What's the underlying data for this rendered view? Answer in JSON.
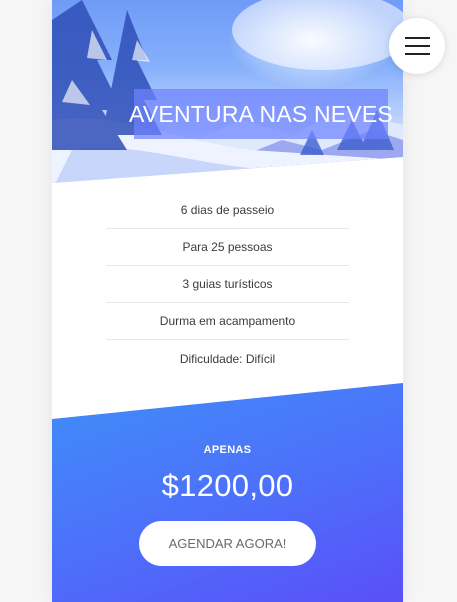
{
  "hero": {
    "title": "AVENTURA NAS NEVES",
    "image": "snowy-mountain-forest-photo"
  },
  "features": [
    "6 dias de passeio",
    "Para 25 pessoas",
    "3 guias turísticos",
    "Durma em acampamento",
    "Dificuldade: Difícil"
  ],
  "pricing": {
    "label": "APENAS",
    "value": "$1200,00",
    "button_label": "AGENDAR AGORA!"
  },
  "menu": {
    "icon": "hamburger-menu-icon"
  },
  "colors": {
    "accent_start": "#3f8ff8",
    "accent_end": "#5a4ff8",
    "title_overlay": "#6e82ff"
  }
}
